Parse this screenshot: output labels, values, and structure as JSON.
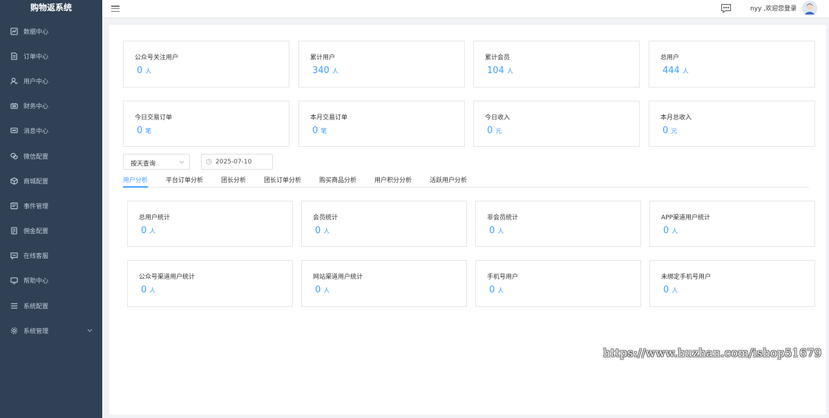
{
  "app": {
    "title": "购物返系统"
  },
  "sidebar": {
    "items": [
      {
        "label": "数据中心",
        "icon": "chart-icon"
      },
      {
        "label": "订单中心",
        "icon": "document-icon"
      },
      {
        "label": "用户中心",
        "icon": "user-icon"
      },
      {
        "label": "财务中心",
        "icon": "wallet-icon"
      },
      {
        "label": "消息中心",
        "icon": "message-icon"
      },
      {
        "label": "微信配置",
        "icon": "wechat-icon"
      },
      {
        "label": "商城配置",
        "icon": "box-icon"
      },
      {
        "label": "事件管理",
        "icon": "list-icon"
      },
      {
        "label": "佣金配置",
        "icon": "commission-icon"
      },
      {
        "label": "在线客服",
        "icon": "chat-icon"
      },
      {
        "label": "帮助中心",
        "icon": "monitor-icon"
      },
      {
        "label": "系统配置",
        "icon": "menu-icon"
      },
      {
        "label": "系统管理",
        "icon": "gear-icon",
        "has_children": true
      }
    ]
  },
  "header": {
    "welcome": "nyy ,欢迎您登录",
    "icons": [
      "hamburger-icon",
      "message-icon",
      "avatar"
    ]
  },
  "summary": {
    "row1": [
      {
        "label": "公众号关注用户",
        "value": "0",
        "unit": "人"
      },
      {
        "label": "累计用户",
        "value": "340",
        "unit": "人"
      },
      {
        "label": "累计会员",
        "value": "104",
        "unit": "人"
      },
      {
        "label": "总用户",
        "value": "444",
        "unit": "人"
      }
    ],
    "row2": [
      {
        "label": "今日交易订单",
        "value": "0",
        "unit": "笔"
      },
      {
        "label": "本月交易订单",
        "value": "0",
        "unit": "笔"
      },
      {
        "label": "今日收入",
        "value": "0",
        "unit": "元"
      },
      {
        "label": "本月总收入",
        "value": "0",
        "unit": "元"
      }
    ]
  },
  "filters": {
    "mode": "按天查询",
    "date": "2025-07-10"
  },
  "tabs": [
    {
      "label": "用户分析",
      "active": true
    },
    {
      "label": "平台订单分析",
      "active": false
    },
    {
      "label": "团长分析",
      "active": false
    },
    {
      "label": "团长订单分析",
      "active": false
    },
    {
      "label": "购买商品分析",
      "active": false
    },
    {
      "label": "用户积分分析",
      "active": false
    },
    {
      "label": "活跃用户分析",
      "active": false
    }
  ],
  "stats": {
    "row1": [
      {
        "label": "总用户统计",
        "value": "0",
        "unit": "人"
      },
      {
        "label": "会员统计",
        "value": "0",
        "unit": "人"
      },
      {
        "label": "非会员统计",
        "value": "0",
        "unit": "人"
      },
      {
        "label": "APP渠道用户统计",
        "value": "0",
        "unit": "人"
      }
    ],
    "row2": [
      {
        "label": "公众号渠道用户统计",
        "value": "0",
        "unit": "人"
      },
      {
        "label": "网站渠道用户统计",
        "value": "0",
        "unit": "人"
      },
      {
        "label": "手机号用户",
        "value": "0",
        "unit": "人"
      },
      {
        "label": "未绑定手机号用户",
        "value": "0",
        "unit": "人"
      }
    ]
  },
  "watermark": "https://www.huzhan.com/ishop51679",
  "colors": {
    "sidebar": "#304156",
    "accent": "#409eff"
  }
}
